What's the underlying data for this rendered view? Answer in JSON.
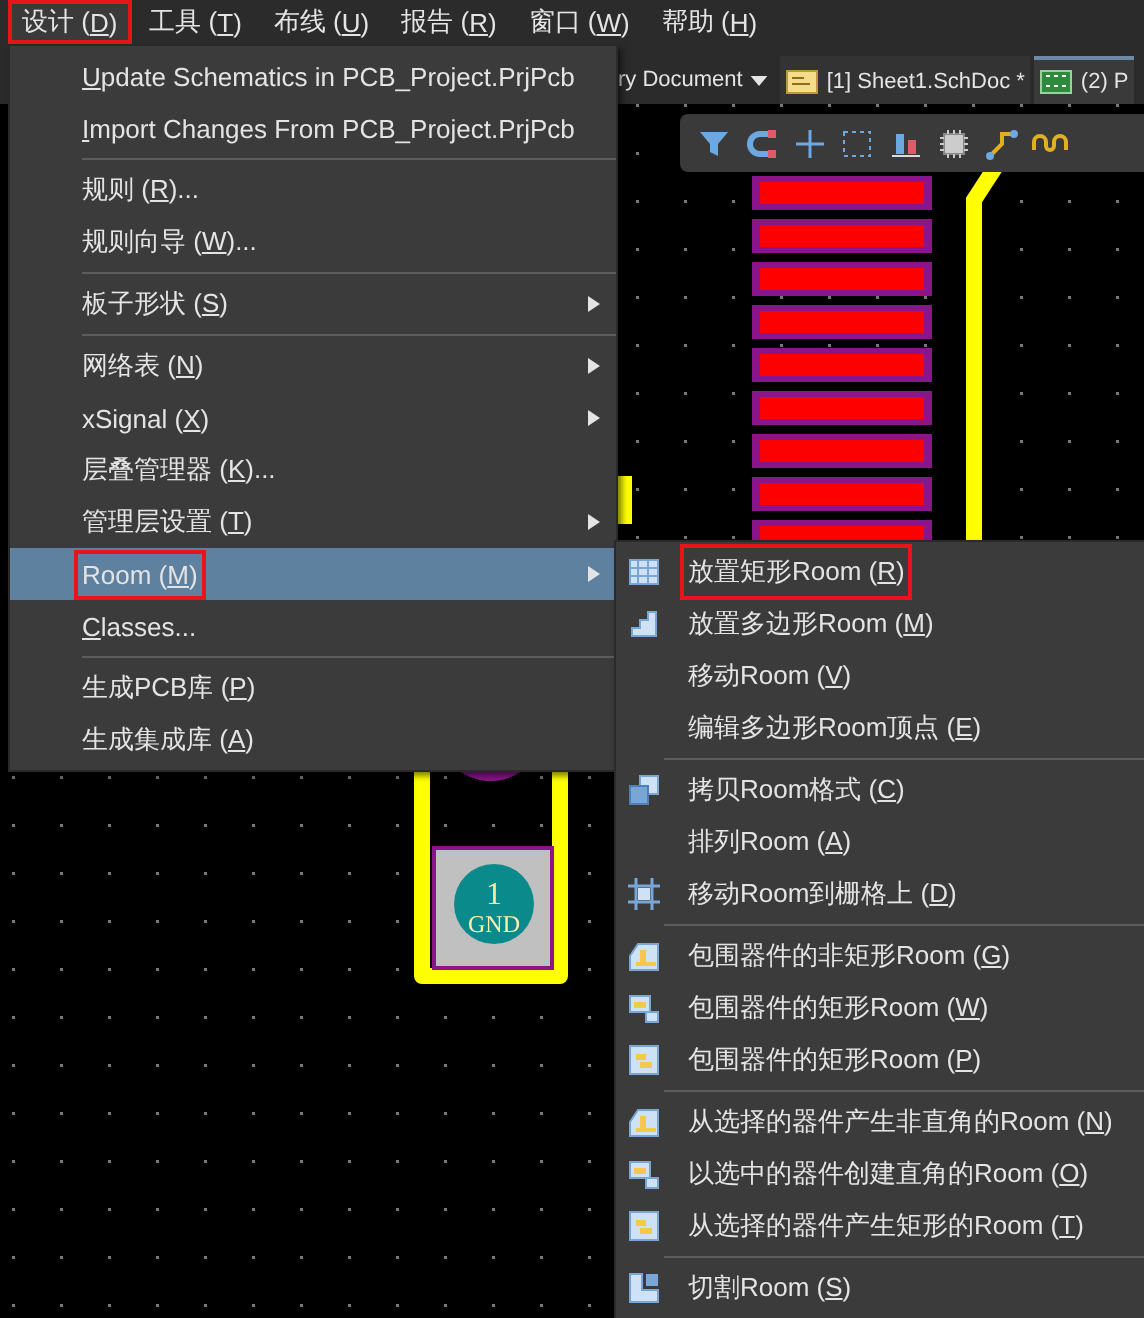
{
  "menu_bar": [
    {
      "label": {
        "before": "设计 (",
        "key": "D",
        "after": ")"
      },
      "selected": true,
      "outlined": true
    },
    {
      "label": {
        "before": "工具 (",
        "key": "T",
        "after": ")"
      },
      "selected": false,
      "outlined": false
    },
    {
      "label": {
        "before": "布线 (",
        "key": "U",
        "after": ")"
      },
      "selected": false,
      "outlined": false
    },
    {
      "label": {
        "before": "报告 (",
        "key": "R",
        "after": ")"
      },
      "selected": false,
      "outlined": false
    },
    {
      "label": {
        "before": "窗口 (",
        "key": "W",
        "after": ")"
      },
      "selected": false,
      "outlined": false
    },
    {
      "label": {
        "before": "帮助 (",
        "key": "H",
        "after": ")"
      },
      "selected": false,
      "outlined": false
    }
  ],
  "document_tabs": {
    "dropdown_label": "ry Document",
    "tabs": [
      {
        "label": "[1] Sheet1.SchDoc *",
        "selected": false
      },
      {
        "label": "(2) P",
        "selected": true
      }
    ]
  },
  "pcb": {
    "pad_number": "1",
    "pad_net": "GND"
  },
  "design_menu": {
    "groups": [
      [
        {
          "label": {
            "key": "U",
            "after": "pdate Schematics in PCB_Project.PrjPcb"
          },
          "submenu": false,
          "selected": false,
          "outlined": false
        },
        {
          "label": {
            "key": "I",
            "after": "mport Changes From PCB_Project.PrjPcb"
          },
          "submenu": false,
          "selected": false,
          "outlined": false
        }
      ],
      [
        {
          "label": {
            "before": "规则 (",
            "key": "R",
            "after": ")..."
          },
          "submenu": false,
          "selected": false,
          "outlined": false
        },
        {
          "label": {
            "before": "规则向导 (",
            "key": "W",
            "after": ")..."
          },
          "submenu": false,
          "selected": false,
          "outlined": false
        }
      ],
      [
        {
          "label": {
            "before": "板子形状 (",
            "key": "S",
            "after": ")"
          },
          "submenu": true,
          "selected": false,
          "outlined": false
        }
      ],
      [
        {
          "label": {
            "before": "网络表 (",
            "key": "N",
            "after": ")"
          },
          "submenu": true,
          "selected": false,
          "outlined": false
        },
        {
          "label": {
            "before": "xSignal (",
            "key": "X",
            "after": ")"
          },
          "submenu": true,
          "selected": false,
          "outlined": false
        },
        {
          "label": {
            "before": "层叠管理器 (",
            "key": "K",
            "after": ")..."
          },
          "submenu": false,
          "selected": false,
          "outlined": false
        },
        {
          "label": {
            "before": "管理层设置 (",
            "key": "T",
            "after": ")"
          },
          "submenu": true,
          "selected": false,
          "outlined": false
        },
        {
          "label": {
            "before": "Room (",
            "key": "M",
            "after": ")"
          },
          "submenu": true,
          "selected": true,
          "outlined": true
        },
        {
          "label": {
            "key": "C",
            "after": "lasses..."
          },
          "submenu": false,
          "selected": false,
          "outlined": false
        }
      ],
      [
        {
          "label": {
            "before": "生成PCB库 (",
            "key": "P",
            "after": ")"
          },
          "submenu": false,
          "selected": false,
          "outlined": false
        },
        {
          "label": {
            "before": "生成集成库 (",
            "key": "A",
            "after": ")"
          },
          "submenu": false,
          "selected": false,
          "outlined": false
        }
      ]
    ]
  },
  "room_submenu": {
    "groups": [
      [
        {
          "label": {
            "before": "放置矩形Room (",
            "key": "R",
            "after": ")"
          },
          "outlined": true
        },
        {
          "label": {
            "before": "放置多边形Room (",
            "key": "M",
            "after": ")"
          },
          "outlined": false
        },
        {
          "label": {
            "before": "移动Room (",
            "key": "V",
            "after": ")"
          },
          "outlined": false
        },
        {
          "label": {
            "before": "编辑多边形Room顶点 (",
            "key": "E",
            "after": ")"
          },
          "outlined": false
        }
      ],
      [
        {
          "label": {
            "before": "拷贝Room格式 (",
            "key": "C",
            "after": ")"
          },
          "outlined": false
        },
        {
          "label": {
            "before": "排列Room (",
            "key": "A",
            "after": ")"
          },
          "outlined": false
        },
        {
          "label": {
            "before": "移动Room到栅格上 (",
            "key": "D",
            "after": ")"
          },
          "outlined": false
        }
      ],
      [
        {
          "label": {
            "before": "包围器件的非矩形Room (",
            "key": "G",
            "after": ")"
          },
          "outlined": false
        },
        {
          "label": {
            "before": "包围器件的矩形Room (",
            "key": "W",
            "after": ")"
          },
          "outlined": false
        },
        {
          "label": {
            "before": "包围器件的矩形Room (",
            "key": "P",
            "after": ")"
          },
          "outlined": false
        }
      ],
      [
        {
          "label": {
            "before": "从选择的器件产生非直角的Room (",
            "key": "N",
            "after": ")"
          },
          "outlined": false
        },
        {
          "label": {
            "before": "以选中的器件创建直角的Room (",
            "key": "O",
            "after": ")"
          },
          "outlined": false
        },
        {
          "label": {
            "before": "从选择的器件产生矩形的Room (",
            "key": "T",
            "after": ")"
          },
          "outlined": false
        }
      ],
      [
        {
          "label": {
            "before": "切割Room (",
            "key": "S",
            "after": ")"
          },
          "outlined": false
        }
      ]
    ]
  }
}
